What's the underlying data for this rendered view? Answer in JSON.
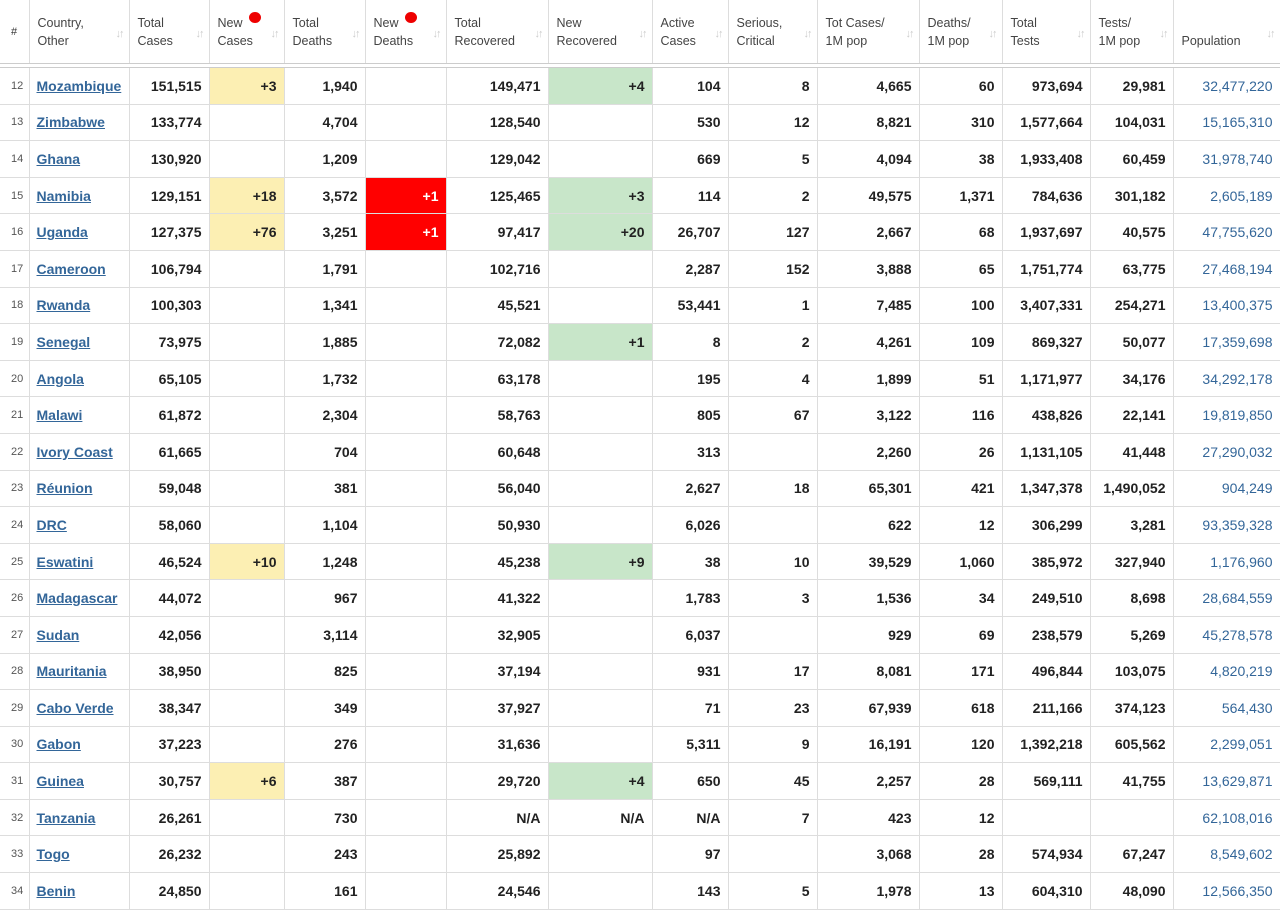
{
  "headers": {
    "num": "#",
    "country": [
      "Country,",
      "Other"
    ],
    "total_cases": [
      "Total",
      "Cases"
    ],
    "new_cases": [
      "New",
      "Cases"
    ],
    "total_deaths": [
      "Total",
      "Deaths"
    ],
    "new_deaths": [
      "New",
      "Deaths"
    ],
    "total_recovered": [
      "Total",
      "Recovered"
    ],
    "new_recovered": [
      "New",
      "Recovered"
    ],
    "active_cases": [
      "Active",
      "Cases"
    ],
    "serious": [
      "Serious,",
      "Critical"
    ],
    "cases_per_m": [
      "Tot Cases/",
      "1M pop"
    ],
    "deaths_per_m": [
      "Deaths/",
      "1M pop"
    ],
    "total_tests": [
      "Total",
      "Tests"
    ],
    "tests_per_m": [
      "Tests/",
      "1M pop"
    ],
    "population": "Population"
  },
  "colors": {
    "new_cases_highlight": "#fcefb3",
    "new_recovered_highlight": "#c8e6c9",
    "new_deaths_highlight": "#ff0000",
    "link": "#336699"
  },
  "rows": [
    {
      "n": "12",
      "country": "Mozambique",
      "tc": "151,515",
      "nc": "+3",
      "td": "1,940",
      "nd": "",
      "tr": "149,471",
      "nr": "+4",
      "ac": "104",
      "sc": "8",
      "tcm": "4,665",
      "dm": "60",
      "tt": "973,694",
      "tm": "29,981",
      "pop": "32,477,220"
    },
    {
      "n": "13",
      "country": "Zimbabwe",
      "tc": "133,774",
      "nc": "",
      "td": "4,704",
      "nd": "",
      "tr": "128,540",
      "nr": "",
      "ac": "530",
      "sc": "12",
      "tcm": "8,821",
      "dm": "310",
      "tt": "1,577,664",
      "tm": "104,031",
      "pop": "15,165,310"
    },
    {
      "n": "14",
      "country": "Ghana",
      "tc": "130,920",
      "nc": "",
      "td": "1,209",
      "nd": "",
      "tr": "129,042",
      "nr": "",
      "ac": "669",
      "sc": "5",
      "tcm": "4,094",
      "dm": "38",
      "tt": "1,933,408",
      "tm": "60,459",
      "pop": "31,978,740"
    },
    {
      "n": "15",
      "country": "Namibia",
      "tc": "129,151",
      "nc": "+18",
      "td": "3,572",
      "nd": "+1",
      "tr": "125,465",
      "nr": "+3",
      "ac": "114",
      "sc": "2",
      "tcm": "49,575",
      "dm": "1,371",
      "tt": "784,636",
      "tm": "301,182",
      "pop": "2,605,189"
    },
    {
      "n": "16",
      "country": "Uganda",
      "tc": "127,375",
      "nc": "+76",
      "td": "3,251",
      "nd": "+1",
      "tr": "97,417",
      "nr": "+20",
      "ac": "26,707",
      "sc": "127",
      "tcm": "2,667",
      "dm": "68",
      "tt": "1,937,697",
      "tm": "40,575",
      "pop": "47,755,620"
    },
    {
      "n": "17",
      "country": "Cameroon",
      "tc": "106,794",
      "nc": "",
      "td": "1,791",
      "nd": "",
      "tr": "102,716",
      "nr": "",
      "ac": "2,287",
      "sc": "152",
      "tcm": "3,888",
      "dm": "65",
      "tt": "1,751,774",
      "tm": "63,775",
      "pop": "27,468,194"
    },
    {
      "n": "18",
      "country": "Rwanda",
      "tc": "100,303",
      "nc": "",
      "td": "1,341",
      "nd": "",
      "tr": "45,521",
      "nr": "",
      "ac": "53,441",
      "sc": "1",
      "tcm": "7,485",
      "dm": "100",
      "tt": "3,407,331",
      "tm": "254,271",
      "pop": "13,400,375"
    },
    {
      "n": "19",
      "country": "Senegal",
      "tc": "73,975",
      "nc": "",
      "td": "1,885",
      "nd": "",
      "tr": "72,082",
      "nr": "+1",
      "ac": "8",
      "sc": "2",
      "tcm": "4,261",
      "dm": "109",
      "tt": "869,327",
      "tm": "50,077",
      "pop": "17,359,698"
    },
    {
      "n": "20",
      "country": "Angola",
      "tc": "65,105",
      "nc": "",
      "td": "1,732",
      "nd": "",
      "tr": "63,178",
      "nr": "",
      "ac": "195",
      "sc": "4",
      "tcm": "1,899",
      "dm": "51",
      "tt": "1,171,977",
      "tm": "34,176",
      "pop": "34,292,178"
    },
    {
      "n": "21",
      "country": "Malawi",
      "tc": "61,872",
      "nc": "",
      "td": "2,304",
      "nd": "",
      "tr": "58,763",
      "nr": "",
      "ac": "805",
      "sc": "67",
      "tcm": "3,122",
      "dm": "116",
      "tt": "438,826",
      "tm": "22,141",
      "pop": "19,819,850"
    },
    {
      "n": "22",
      "country": "Ivory Coast",
      "tc": "61,665",
      "nc": "",
      "td": "704",
      "nd": "",
      "tr": "60,648",
      "nr": "",
      "ac": "313",
      "sc": "",
      "tcm": "2,260",
      "dm": "26",
      "tt": "1,131,105",
      "tm": "41,448",
      "pop": "27,290,032"
    },
    {
      "n": "23",
      "country": "Réunion",
      "tc": "59,048",
      "nc": "",
      "td": "381",
      "nd": "",
      "tr": "56,040",
      "nr": "",
      "ac": "2,627",
      "sc": "18",
      "tcm": "65,301",
      "dm": "421",
      "tt": "1,347,378",
      "tm": "1,490,052",
      "pop": "904,249"
    },
    {
      "n": "24",
      "country": "DRC",
      "tc": "58,060",
      "nc": "",
      "td": "1,104",
      "nd": "",
      "tr": "50,930",
      "nr": "",
      "ac": "6,026",
      "sc": "",
      "tcm": "622",
      "dm": "12",
      "tt": "306,299",
      "tm": "3,281",
      "pop": "93,359,328"
    },
    {
      "n": "25",
      "country": "Eswatini",
      "tc": "46,524",
      "nc": "+10",
      "td": "1,248",
      "nd": "",
      "tr": "45,238",
      "nr": "+9",
      "ac": "38",
      "sc": "10",
      "tcm": "39,529",
      "dm": "1,060",
      "tt": "385,972",
      "tm": "327,940",
      "pop": "1,176,960"
    },
    {
      "n": "26",
      "country": "Madagascar",
      "tc": "44,072",
      "nc": "",
      "td": "967",
      "nd": "",
      "tr": "41,322",
      "nr": "",
      "ac": "1,783",
      "sc": "3",
      "tcm": "1,536",
      "dm": "34",
      "tt": "249,510",
      "tm": "8,698",
      "pop": "28,684,559"
    },
    {
      "n": "27",
      "country": "Sudan",
      "tc": "42,056",
      "nc": "",
      "td": "3,114",
      "nd": "",
      "tr": "32,905",
      "nr": "",
      "ac": "6,037",
      "sc": "",
      "tcm": "929",
      "dm": "69",
      "tt": "238,579",
      "tm": "5,269",
      "pop": "45,278,578"
    },
    {
      "n": "28",
      "country": "Mauritania",
      "tc": "38,950",
      "nc": "",
      "td": "825",
      "nd": "",
      "tr": "37,194",
      "nr": "",
      "ac": "931",
      "sc": "17",
      "tcm": "8,081",
      "dm": "171",
      "tt": "496,844",
      "tm": "103,075",
      "pop": "4,820,219"
    },
    {
      "n": "29",
      "country": "Cabo Verde",
      "tc": "38,347",
      "nc": "",
      "td": "349",
      "nd": "",
      "tr": "37,927",
      "nr": "",
      "ac": "71",
      "sc": "23",
      "tcm": "67,939",
      "dm": "618",
      "tt": "211,166",
      "tm": "374,123",
      "pop": "564,430"
    },
    {
      "n": "30",
      "country": "Gabon",
      "tc": "37,223",
      "nc": "",
      "td": "276",
      "nd": "",
      "tr": "31,636",
      "nr": "",
      "ac": "5,311",
      "sc": "9",
      "tcm": "16,191",
      "dm": "120",
      "tt": "1,392,218",
      "tm": "605,562",
      "pop": "2,299,051"
    },
    {
      "n": "31",
      "country": "Guinea",
      "tc": "30,757",
      "nc": "+6",
      "td": "387",
      "nd": "",
      "tr": "29,720",
      "nr": "+4",
      "ac": "650",
      "sc": "45",
      "tcm": "2,257",
      "dm": "28",
      "tt": "569,111",
      "tm": "41,755",
      "pop": "13,629,871"
    },
    {
      "n": "32",
      "country": "Tanzania",
      "tc": "26,261",
      "nc": "",
      "td": "730",
      "nd": "",
      "tr": "N/A",
      "nr": "N/A",
      "ac": "N/A",
      "sc": "7",
      "tcm": "423",
      "dm": "12",
      "tt": "",
      "tm": "",
      "pop": "62,108,016"
    },
    {
      "n": "33",
      "country": "Togo",
      "tc": "26,232",
      "nc": "",
      "td": "243",
      "nd": "",
      "tr": "25,892",
      "nr": "",
      "ac": "97",
      "sc": "",
      "tcm": "3,068",
      "dm": "28",
      "tt": "574,934",
      "tm": "67,247",
      "pop": "8,549,602"
    },
    {
      "n": "34",
      "country": "Benin",
      "tc": "24,850",
      "nc": "",
      "td": "161",
      "nd": "",
      "tr": "24,546",
      "nr": "",
      "ac": "143",
      "sc": "5",
      "tcm": "1,978",
      "dm": "13",
      "tt": "604,310",
      "tm": "48,090",
      "pop": "12,566,350"
    }
  ]
}
